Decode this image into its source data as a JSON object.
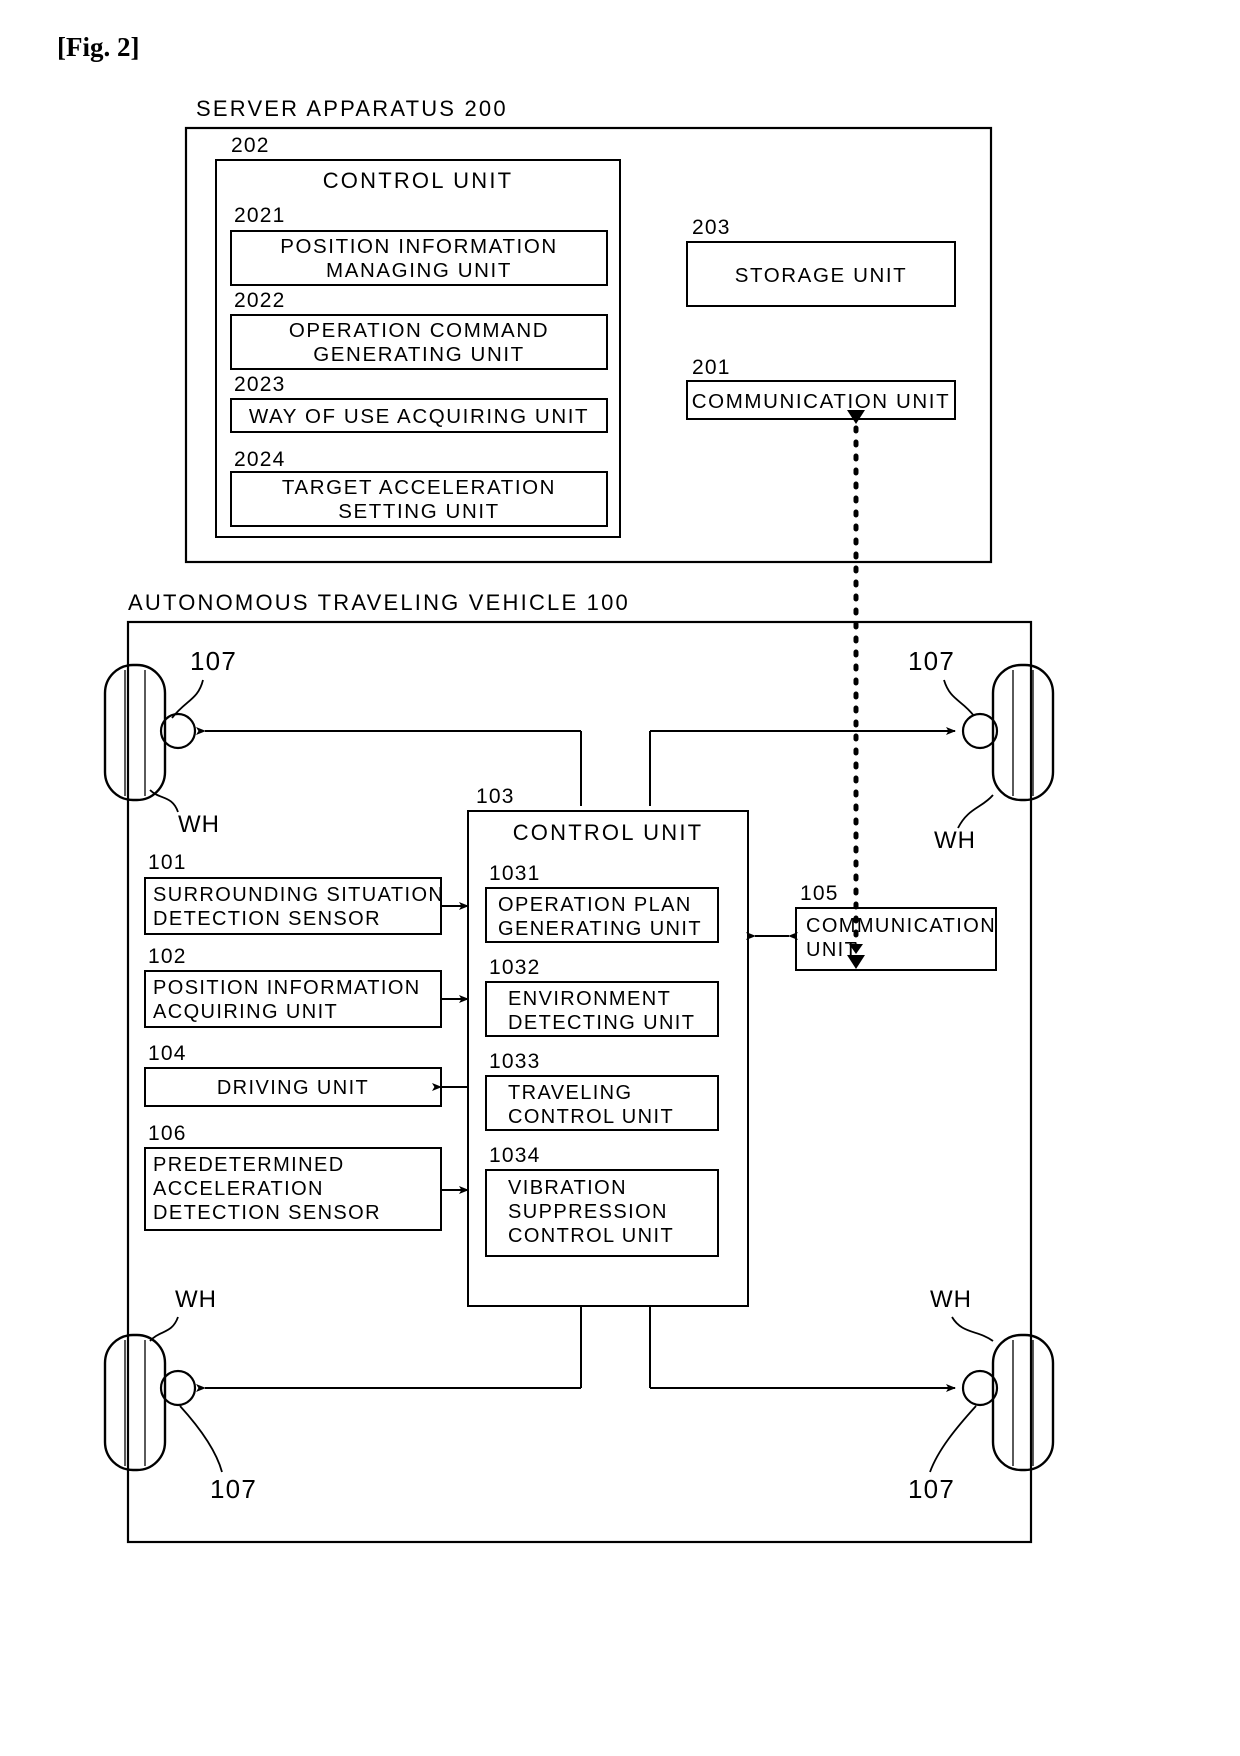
{
  "figure": {
    "label": "[Fig. 2]"
  },
  "server": {
    "title": "SERVER APPARATUS 200",
    "control_unit": {
      "ref": "202",
      "title": "CONTROL UNIT",
      "modules": [
        {
          "ref": "2021",
          "lines": [
            "POSITION  INFORMATION",
            "MANAGING  UNIT"
          ]
        },
        {
          "ref": "2022",
          "lines": [
            "OPERATION  COMMAND",
            "GENERATING  UNIT"
          ]
        },
        {
          "ref": "2023",
          "lines": [
            "WAY  OF  USE  ACQUIRING  UNIT"
          ]
        },
        {
          "ref": "2024",
          "lines": [
            "TARGET  ACCELERATION",
            "SETTING  UNIT"
          ]
        }
      ]
    },
    "storage_unit": {
      "ref": "203",
      "lines": [
        "STORAGE  UNIT"
      ]
    },
    "communication_unit": {
      "ref": "201",
      "lines": [
        "COMMUNICATION  UNIT"
      ]
    }
  },
  "vehicle": {
    "title": "AUTONOMOUS  TRAVELING  VEHICLE  100",
    "wheels": [
      {
        "id": "front-left",
        "motor_ref": "107",
        "wheel_ref": "WH"
      },
      {
        "id": "front-right",
        "motor_ref": "107",
        "wheel_ref": "WH"
      },
      {
        "id": "rear-left",
        "motor_ref": "107",
        "wheel_ref": "WH"
      },
      {
        "id": "rear-right",
        "motor_ref": "107",
        "wheel_ref": "WH"
      }
    ],
    "left_components": [
      {
        "ref": "101",
        "lines": [
          "SURROUNDING  SITUATION",
          "DETECTION  SENSOR"
        ]
      },
      {
        "ref": "102",
        "lines": [
          "POSITION  INFORMATION",
          "ACQUIRING  UNIT"
        ]
      },
      {
        "ref": "104",
        "lines": [
          "DRIVING  UNIT"
        ]
      },
      {
        "ref": "106",
        "lines": [
          "PREDETERMINED",
          "ACCELERATION",
          "DETECTION  SENSOR"
        ]
      }
    ],
    "control_unit": {
      "ref": "103",
      "title": "CONTROL  UNIT",
      "modules": [
        {
          "ref": "1031",
          "lines": [
            "OPERATION  PLAN",
            "GENERATING  UNIT"
          ]
        },
        {
          "ref": "1032",
          "lines": [
            "ENVIRONMENT",
            "DETECTING  UNIT"
          ]
        },
        {
          "ref": "1033",
          "lines": [
            "TRAVELING",
            "CONTROL  UNIT"
          ]
        },
        {
          "ref": "1034",
          "lines": [
            "VIBRATION",
            "SUPPRESSION",
            "CONTROL  UNIT"
          ]
        }
      ]
    },
    "communication_unit": {
      "ref": "105",
      "lines": [
        "COMMUNICATION",
        "UNIT"
      ]
    }
  },
  "colors": {
    "ink": "#000000",
    "paper": "#ffffff"
  }
}
